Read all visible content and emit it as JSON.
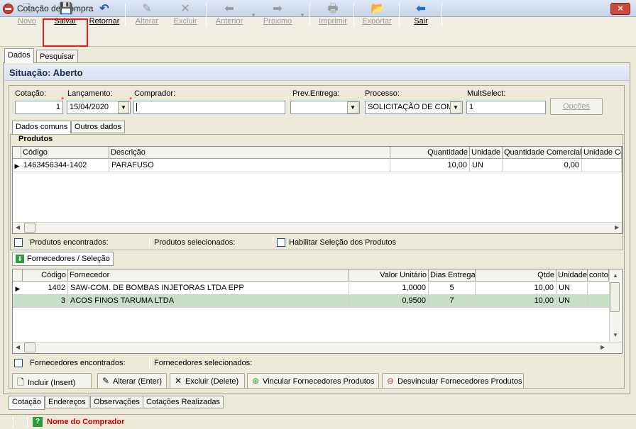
{
  "window": {
    "title": "Cotação de Compra",
    "close_glyph": "×"
  },
  "toolbar": {
    "buttons": [
      {
        "label": "Novo",
        "icon": "new-document-icon",
        "glyph": "🗋",
        "enabled": false
      },
      {
        "label": "Salvar",
        "icon": "save-disk-icon",
        "glyph": "💾",
        "enabled": true
      },
      {
        "label": "Retornar",
        "icon": "undo-icon",
        "glyph": "↶",
        "enabled": true
      },
      {
        "label": "Alterar",
        "icon": "edit-icon",
        "glyph": "✎",
        "enabled": false
      },
      {
        "label": "Excluir",
        "icon": "delete-x-icon",
        "glyph": "✕",
        "enabled": false
      },
      {
        "label": "Anterior",
        "icon": "arrow-left-icon",
        "glyph": "⬅",
        "enabled": false
      },
      {
        "label": "Proximo",
        "icon": "arrow-right-icon",
        "glyph": "➡",
        "enabled": false
      },
      {
        "label": "Imprimir",
        "icon": "printer-icon",
        "glyph": "🖶",
        "enabled": false
      },
      {
        "label": "Exportar",
        "icon": "export-folder-icon",
        "glyph": "📂",
        "enabled": false
      },
      {
        "label": "Sair",
        "icon": "exit-arrow-icon",
        "glyph": "⬅",
        "enabled": true
      }
    ]
  },
  "main_tabs": [
    {
      "label": "Dados",
      "active": true
    },
    {
      "label": "Pesquisar",
      "active": false
    }
  ],
  "situacao": "Situação: Aberto",
  "form": {
    "cotacao": {
      "label": "Cotação:",
      "value": "1"
    },
    "lancamento": {
      "label": "Lançamento:",
      "value": "15/04/2020"
    },
    "comprador": {
      "label": "Comprador:",
      "value": ""
    },
    "prev_entrega": {
      "label": "Prev.Entrega:",
      "value": ""
    },
    "processo": {
      "label": "Processo:",
      "value": "SOLICITAÇÃO DE COM"
    },
    "multselect": {
      "label": "MultSelect:",
      "value": "1"
    },
    "opcoes_label": "Opções",
    "required_mark": "*"
  },
  "sub_tabs": [
    {
      "label": "Dados comuns",
      "active": true
    },
    {
      "label": "Outros dados",
      "active": false
    }
  ],
  "produtos": {
    "title": "Produtos",
    "columns": [
      "Código",
      "Descrição",
      "Quantidade",
      "Unidade",
      "Quantidade Comercial",
      "Unidade Co"
    ],
    "rows": [
      {
        "codigo": "1463456344-1402",
        "descricao": "PARAFUSO",
        "quantidade": "10,00",
        "unidade": "UN",
        "qtd_comercial": "0,00",
        "unidade_com": ""
      }
    ],
    "encontrados_label": "Produtos encontrados:",
    "selecionados_label": "Produtos selecionados:",
    "habilitar_label": "Habilitar Seleção dos Produtos"
  },
  "fornecedores": {
    "tab_label": "Fornecedores / Seleção",
    "columns": [
      "Código",
      "Fornecedor",
      "Valor Unitário",
      "Dias Entrega",
      "Qtde",
      "Unidade",
      "conto"
    ],
    "rows": [
      {
        "codigo": "1402",
        "fornecedor": "SAW-COM. DE BOMBAS INJETORAS LTDA EPP",
        "valor": "1,0000",
        "dias": "5",
        "qtde": "10,00",
        "unidade": "UN",
        "selected": false,
        "current": true
      },
      {
        "codigo": "3",
        "fornecedor": "ACOS FINOS TARUMA LTDA",
        "valor": "0,9500",
        "dias": "7",
        "qtde": "10,00",
        "unidade": "UN",
        "selected": true,
        "current": false
      }
    ],
    "encontrados_label": "Fornecedores encontrados:",
    "selecionados_label": "Fornecedores selecionados:"
  },
  "actions": [
    {
      "label": "Incluir (Insert)",
      "icon": "new-page-icon",
      "glyph": "🗋"
    },
    {
      "label": "Alterar (Enter)",
      "icon": "edit-pencil-icon",
      "glyph": "✎"
    },
    {
      "label": "Excluir (Delete)",
      "icon": "delete-x-icon",
      "glyph": "✕"
    },
    {
      "label": "Vincular Fornecedores Produtos",
      "icon": "link-add-icon",
      "glyph": "⊕"
    },
    {
      "label": "Desvincular Fornecedores Produtos",
      "icon": "link-remove-icon",
      "glyph": "⊖"
    }
  ],
  "bottom_tabs": [
    {
      "label": "Cotação",
      "active": true
    },
    {
      "label": "Endereços",
      "active": false
    },
    {
      "label": "Observações",
      "active": false
    },
    {
      "label": "Cotações Realizadas",
      "active": false
    }
  ],
  "statusbar": {
    "help_glyph": "?",
    "hint": "Nome do Comprador",
    "hint_color": "#cc0000"
  }
}
